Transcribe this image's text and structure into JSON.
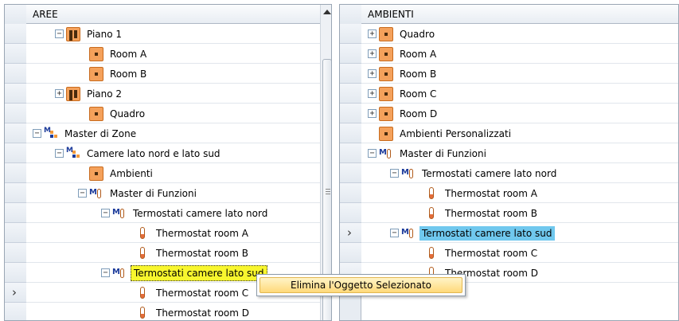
{
  "left": {
    "header": "AREE",
    "rows": [
      {
        "label": "Piano 1",
        "icon": "floor-icon",
        "expander": "minus"
      },
      {
        "label": "Room A",
        "icon": "room-icon",
        "expander": "none"
      },
      {
        "label": "Room B",
        "icon": "room-icon",
        "expander": "none"
      },
      {
        "label": "Piano 2",
        "icon": "floor-icon",
        "expander": "plus"
      },
      {
        "label": "Quadro",
        "icon": "room-icon",
        "expander": "none"
      },
      {
        "label": "Master di Zone",
        "icon": "master-zone-icon",
        "expander": "minus"
      },
      {
        "label": "Camere lato nord e lato sud",
        "icon": "master-zone-icon",
        "expander": "minus"
      },
      {
        "label": "Ambienti",
        "icon": "room-icon",
        "expander": "none"
      },
      {
        "label": "Master di Funzioni",
        "icon": "master-function-icon",
        "expander": "minus"
      },
      {
        "label": "Termostati camere lato nord",
        "icon": "master-function-icon",
        "expander": "minus"
      },
      {
        "label": "Thermostat room A",
        "icon": "thermostat-icon",
        "expander": "none"
      },
      {
        "label": "Thermostat room B",
        "icon": "thermostat-icon",
        "expander": "none"
      },
      {
        "label": "Termostati camere lato sud",
        "icon": "master-function-icon",
        "expander": "minus",
        "selected": "yellow"
      },
      {
        "label": "Thermostat room C",
        "icon": "thermostat-icon",
        "expander": "none"
      },
      {
        "label": "Thermostat room D",
        "icon": "thermostat-icon",
        "expander": "none"
      }
    ]
  },
  "right": {
    "header": "AMBIENTI",
    "rows": [
      {
        "label": "Quadro",
        "icon": "room-icon",
        "expander": "plus"
      },
      {
        "label": "Room A",
        "icon": "room-icon",
        "expander": "plus"
      },
      {
        "label": "Room B",
        "icon": "room-icon",
        "expander": "plus"
      },
      {
        "label": "Room C",
        "icon": "room-icon",
        "expander": "plus"
      },
      {
        "label": "Room D",
        "icon": "room-icon",
        "expander": "plus"
      },
      {
        "label": "Ambienti Personalizzati",
        "icon": "custom-room-icon",
        "expander": "none"
      },
      {
        "label": "Master di Funzioni",
        "icon": "master-function-icon",
        "expander": "minus"
      },
      {
        "label": "Termostati camere lato nord",
        "icon": "master-function-icon",
        "expander": "minus"
      },
      {
        "label": "Thermostat room A",
        "icon": "thermostat-icon",
        "expander": "none"
      },
      {
        "label": "Thermostat room B",
        "icon": "thermostat-icon",
        "expander": "none"
      },
      {
        "label": "Termostati camere lato sud",
        "icon": "master-function-icon",
        "expander": "minus",
        "selected": "blue"
      },
      {
        "label": "Thermostat room C",
        "icon": "thermostat-icon",
        "expander": "none"
      },
      {
        "label": "Thermostat room D",
        "icon": "thermostat-icon",
        "expander": "none"
      }
    ]
  },
  "context_menu": {
    "item": "Elimina l'Oggetto Selezionato"
  },
  "colors": {
    "selection_yellow": "#f8f62e",
    "selection_blue": "#70c8ee",
    "icon_orange": "#f4a15b"
  }
}
